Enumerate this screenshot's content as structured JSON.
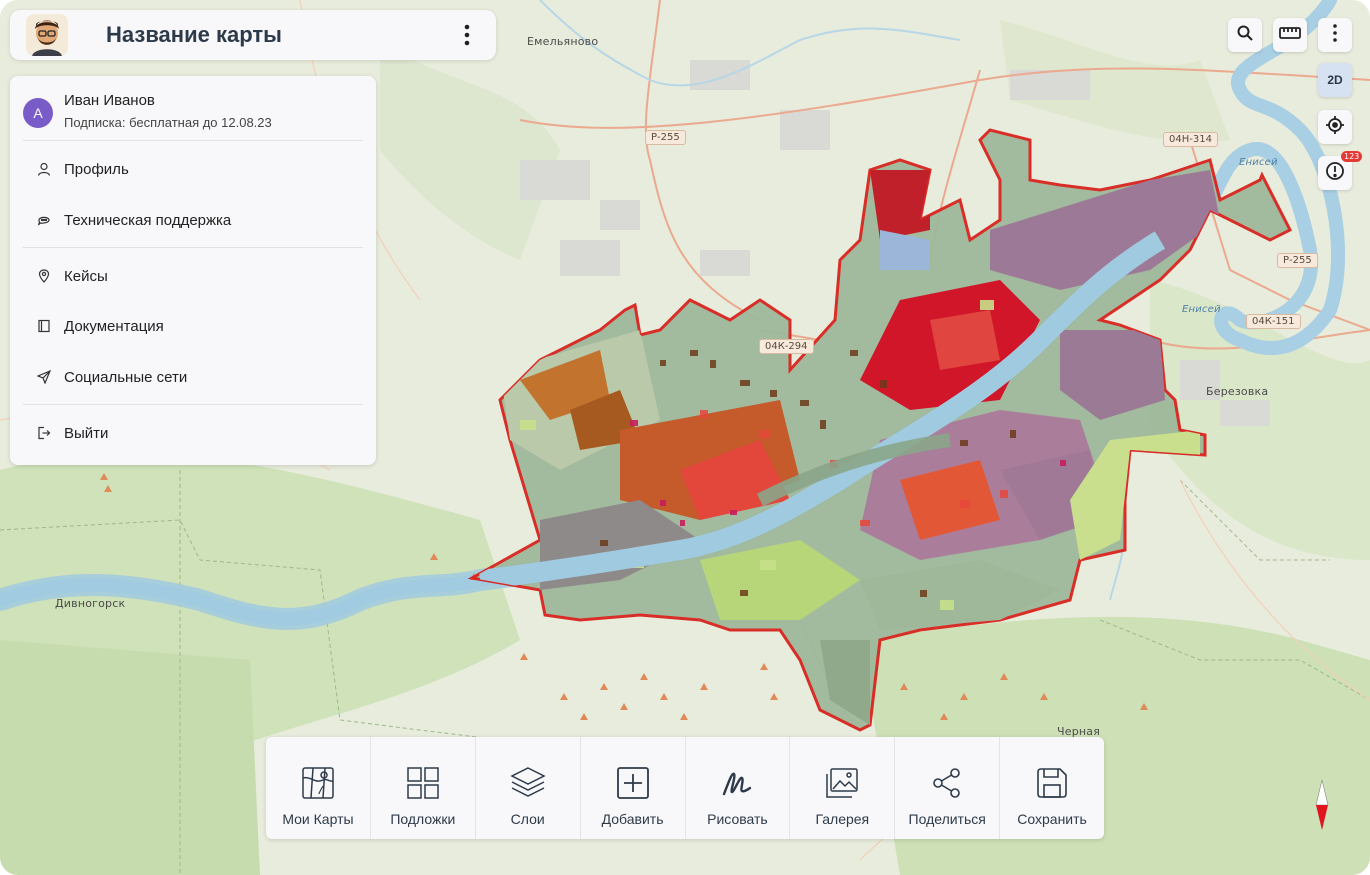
{
  "header": {
    "title": "Название карты",
    "avatar_icon": "avatar-icon",
    "menu_icon": "kebab-icon"
  },
  "user_menu": {
    "avatar_letter": "А",
    "name": "Иван Иванов",
    "subscription": "Подписка: бесплатная до 12.08.23",
    "items": [
      {
        "label": "Профиль",
        "icon": "user-icon"
      },
      {
        "label": "Техническая поддержка",
        "icon": "chat-icon"
      },
      {
        "label": "Кейсы",
        "icon": "map-pin-icon"
      },
      {
        "label": "Документация",
        "icon": "book-icon"
      },
      {
        "label": "Социальные сети",
        "icon": "send-icon"
      },
      {
        "label": "Выйти",
        "icon": "logout-icon"
      }
    ]
  },
  "map_controls": {
    "view_mode": "2D",
    "notifications_count": "123"
  },
  "map_labels": {
    "emelyanovo": "Емельяново",
    "divnogorsk": "Дивногорск",
    "berezovka": "Березовка",
    "chernaya": "Черная",
    "yenisei_1": "Енисей",
    "yenisei_2": "Енисей"
  },
  "road_shields": {
    "r255_left": "Р-255",
    "r255_right": "Р-255",
    "r04h314": "04Н-314",
    "r04k294": "04К-294",
    "r04k151": "04К-151"
  },
  "toolbar": {
    "items": [
      {
        "label": "Мои Карты",
        "icon": "my-maps-icon"
      },
      {
        "label": "Подложки",
        "icon": "basemaps-icon"
      },
      {
        "label": "Слои",
        "icon": "layers-icon"
      },
      {
        "label": "Добавить",
        "icon": "add-icon"
      },
      {
        "label": "Рисовать",
        "icon": "draw-icon"
      },
      {
        "label": "Галерея",
        "icon": "gallery-icon"
      },
      {
        "label": "Поделиться",
        "icon": "share-icon"
      },
      {
        "label": "Сохранить",
        "icon": "save-icon"
      }
    ]
  },
  "colors": {
    "accent_avatar": "#7a5cc8",
    "badge": "#e53935",
    "text_primary": "#2d3a4a",
    "view_mode_bg": "#d6e2f1"
  }
}
